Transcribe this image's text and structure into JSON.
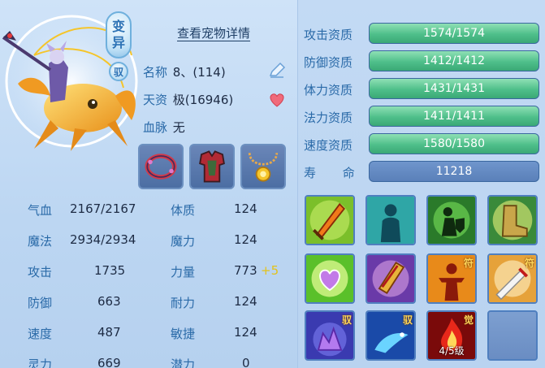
{
  "header": {
    "mutant_badge": [
      "变",
      "异"
    ],
    "tame_badge": "驭",
    "detail_link": "查看宠物详情"
  },
  "info": {
    "name_label": "名称",
    "name_value": "8、(114)",
    "talent_label": "天资",
    "talent_value": "极(16946)",
    "bloodline_label": "血脉",
    "bloodline_value": "无"
  },
  "equipment": [
    {
      "icon": "red-bracelet-icon"
    },
    {
      "icon": "armor-icon"
    },
    {
      "icon": "necklace-icon"
    }
  ],
  "stats": [
    {
      "label1": "气血",
      "value1": "2167/2167",
      "label2": "体质",
      "value2": "124"
    },
    {
      "label1": "魔法",
      "value1": "2934/2934",
      "label2": "魔力",
      "value2": "124"
    },
    {
      "label1": "攻击",
      "value1": "1735",
      "label2": "力量",
      "value2": "773",
      "bonus2": "+5"
    },
    {
      "label1": "防御",
      "value1": "663",
      "label2": "耐力",
      "value2": "124"
    },
    {
      "label1": "速度",
      "value1": "487",
      "label2": "敏捷",
      "value2": "124"
    },
    {
      "label1": "灵力",
      "value1": "669",
      "label2": "潜力",
      "value2": "0"
    }
  ],
  "aptitudes": [
    {
      "label": "攻击资质",
      "value": "1574/1574",
      "fill": 1.0
    },
    {
      "label": "防御资质",
      "value": "1412/1412",
      "fill": 1.0
    },
    {
      "label": "体力资质",
      "value": "1431/1431",
      "fill": 1.0
    },
    {
      "label": "法力资质",
      "value": "1411/1411",
      "fill": 1.0
    },
    {
      "label": "速度资质",
      "value": "1580/1580",
      "fill": 1.0
    },
    {
      "label": "寿 命",
      "value": "11218",
      "fill": 0
    }
  ],
  "skills": [
    {
      "icon": "flaming-sword-icon",
      "tag": "",
      "level": ""
    },
    {
      "icon": "shadow-figure-icon",
      "tag": "",
      "level": ""
    },
    {
      "icon": "shield-warrior-icon",
      "tag": "",
      "level": ""
    },
    {
      "icon": "speed-boot-icon",
      "tag": "",
      "level": ""
    },
    {
      "icon": "heart-glow-icon",
      "tag": "",
      "level": ""
    },
    {
      "icon": "golden-scroll-icon",
      "tag": "",
      "level": ""
    },
    {
      "icon": "red-figure-icon",
      "tag": "符",
      "level": ""
    },
    {
      "icon": "silver-sword-icon",
      "tag": "符",
      "level": ""
    },
    {
      "icon": "purple-crystal-icon",
      "tag": "驭",
      "level": ""
    },
    {
      "icon": "blue-beast-icon",
      "tag": "驭",
      "level": ""
    },
    {
      "icon": "red-flame-icon",
      "tag": "觉",
      "level": "4/5级"
    },
    {
      "icon": "empty-slot-icon",
      "tag": "",
      "level": ""
    }
  ],
  "colors": {
    "label_blue": "#2a6aa8",
    "value_dark": "#1d2b44",
    "bar_green": "#4fbf8a",
    "bar_blue": "#5a80b9",
    "bonus_yellow": "#e3c21a"
  }
}
